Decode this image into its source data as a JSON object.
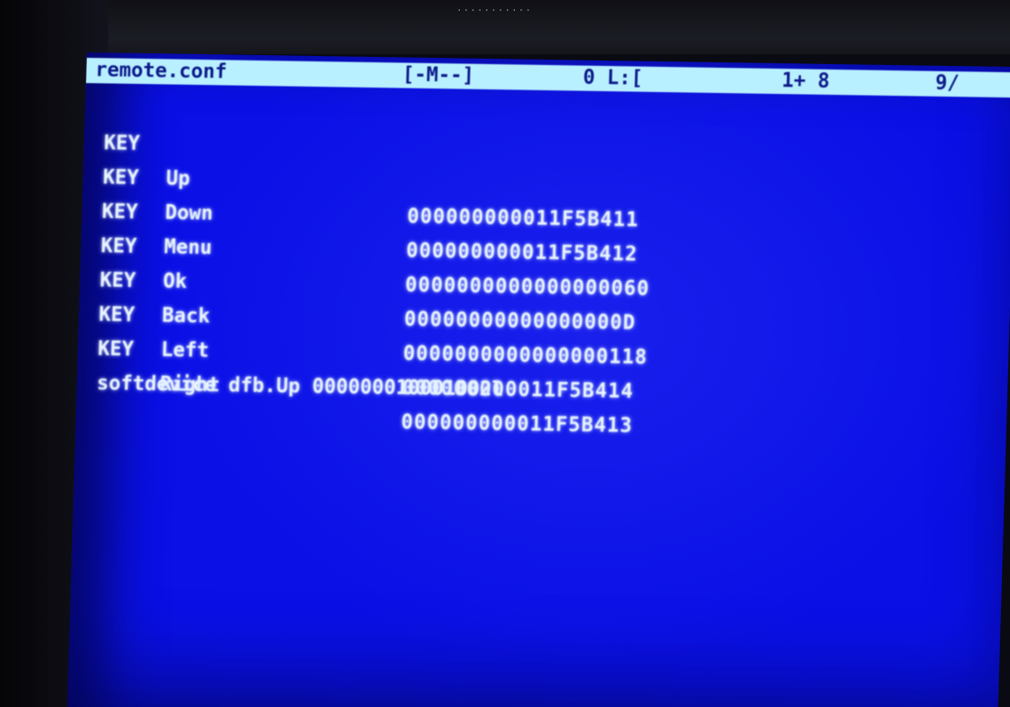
{
  "bezel": {
    "top_text": "..........."
  },
  "editor": {
    "title_bar": {
      "filename": "remote.conf",
      "mode": "[-M--]",
      "position": "0 L:[",
      "chars": "1+ 8",
      "percent": "9/"
    },
    "lines": [
      {
        "keyword": "KEY",
        "name": "Up",
        "code": "000000000011F5B411"
      },
      {
        "keyword": "KEY",
        "name": "Down",
        "code": "000000000011F5B412"
      },
      {
        "keyword": "KEY",
        "name": "Menu",
        "code": "0000000000000000060"
      },
      {
        "keyword": "KEY",
        "name": "Ok",
        "code": "00000000000000000D"
      },
      {
        "keyword": "KEY",
        "name": "Back",
        "code": "0000000000000000118"
      },
      {
        "keyword": "KEY",
        "name": "Left",
        "code": "000000000011F5B414"
      },
      {
        "keyword": "KEY",
        "name": "Right",
        "code": "000000000011F5B413"
      }
    ],
    "last_line": "softdevice dfb.Up 000000010001002l"
  },
  "colors": {
    "screen_bg": "#0a10e6",
    "title_bar_bg": "#b8f0ff",
    "title_bar_text": "#0d1a8a",
    "text": "#e8f4ff"
  }
}
